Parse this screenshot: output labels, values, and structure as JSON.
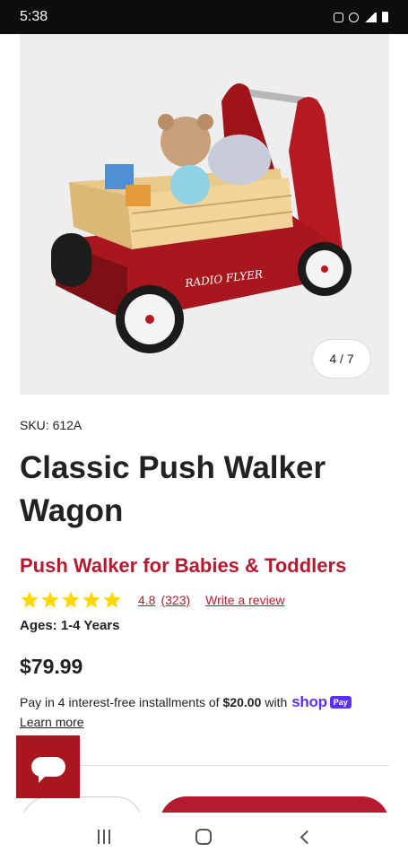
{
  "status_bar": {
    "time": "5:38"
  },
  "gallery": {
    "counter": "4 / 7",
    "logo_text": "RADIO FLYER"
  },
  "product": {
    "sku": "SKU: 612A",
    "title": "Classic Push Walker Wagon",
    "subtitle": "Push Walker for Babies & Toddlers",
    "rating": {
      "stars": 5,
      "value": "4.8",
      "count": "(323)",
      "write_review": "Write a review"
    },
    "ages": "Ages: 1-4 Years",
    "price": "$79.99"
  },
  "installments": {
    "prefix": "Pay in 4 interest-free installments of",
    "amount": "$20.00",
    "suffix": "with",
    "shop_logo": "shop",
    "pay_badge": "Pay",
    "learn_more": "Learn more"
  },
  "colors": {
    "brand_red": "#b51a30",
    "chat_red": "#a8171d",
    "shop_purple": "#5a31f4",
    "star_yellow": "#ffd700"
  },
  "icons": {
    "chat": "chat-bubble-icon",
    "recents": "recents-icon",
    "home": "home-icon",
    "back": "back-icon"
  }
}
